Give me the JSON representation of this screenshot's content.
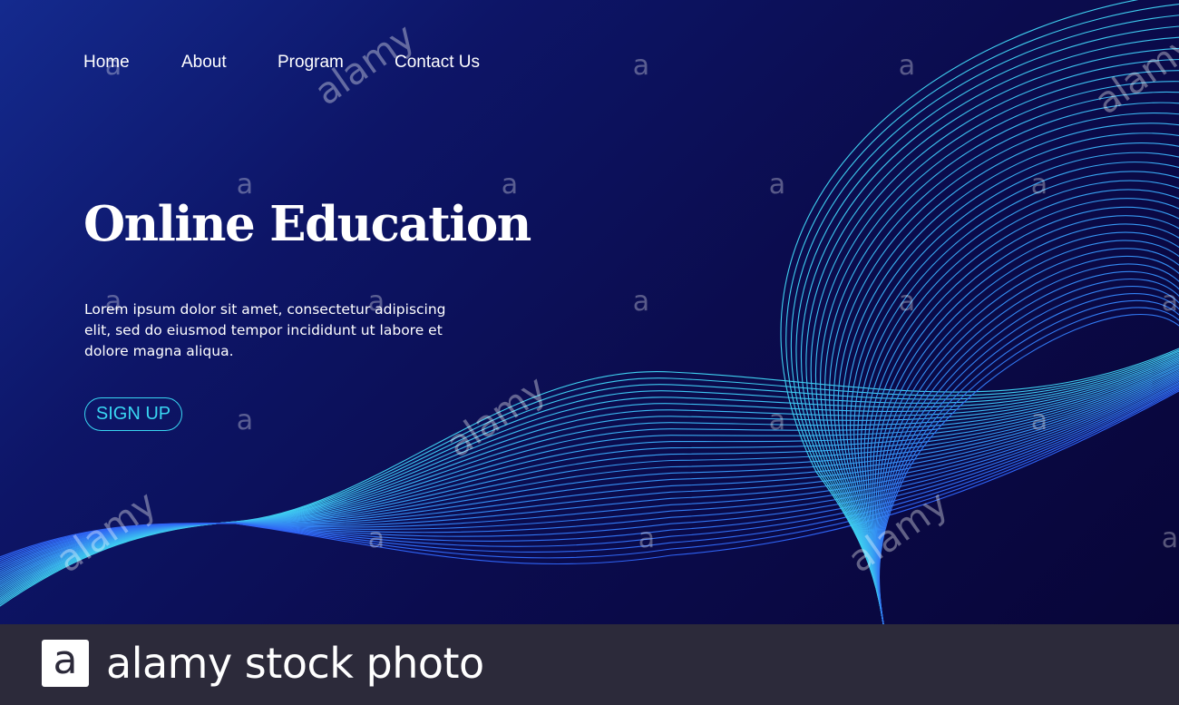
{
  "nav": {
    "items": [
      {
        "label": "Home"
      },
      {
        "label": "About"
      },
      {
        "label": "Program"
      },
      {
        "label": "Contact Us"
      }
    ]
  },
  "hero": {
    "title": "Online Education",
    "body": "Lorem ipsum dolor sit amet, consectetur adipiscing elit, sed do eiusmod tempor incididunt ut labore et dolore magna aliqua.",
    "cta_label": "SIGN UP"
  },
  "footer": {
    "logo_letter": "a",
    "text": "alamy stock photo"
  },
  "watermark": {
    "word": "alamy",
    "letter": "a"
  },
  "colors": {
    "background_dark": "#0b0a3c",
    "background_accent": "#142a8e",
    "wave_cyan": "#3fd0f0",
    "wave_blue": "#2f63f5",
    "cta": "#39d6f2",
    "footer_bg": "#2c2a3a"
  }
}
